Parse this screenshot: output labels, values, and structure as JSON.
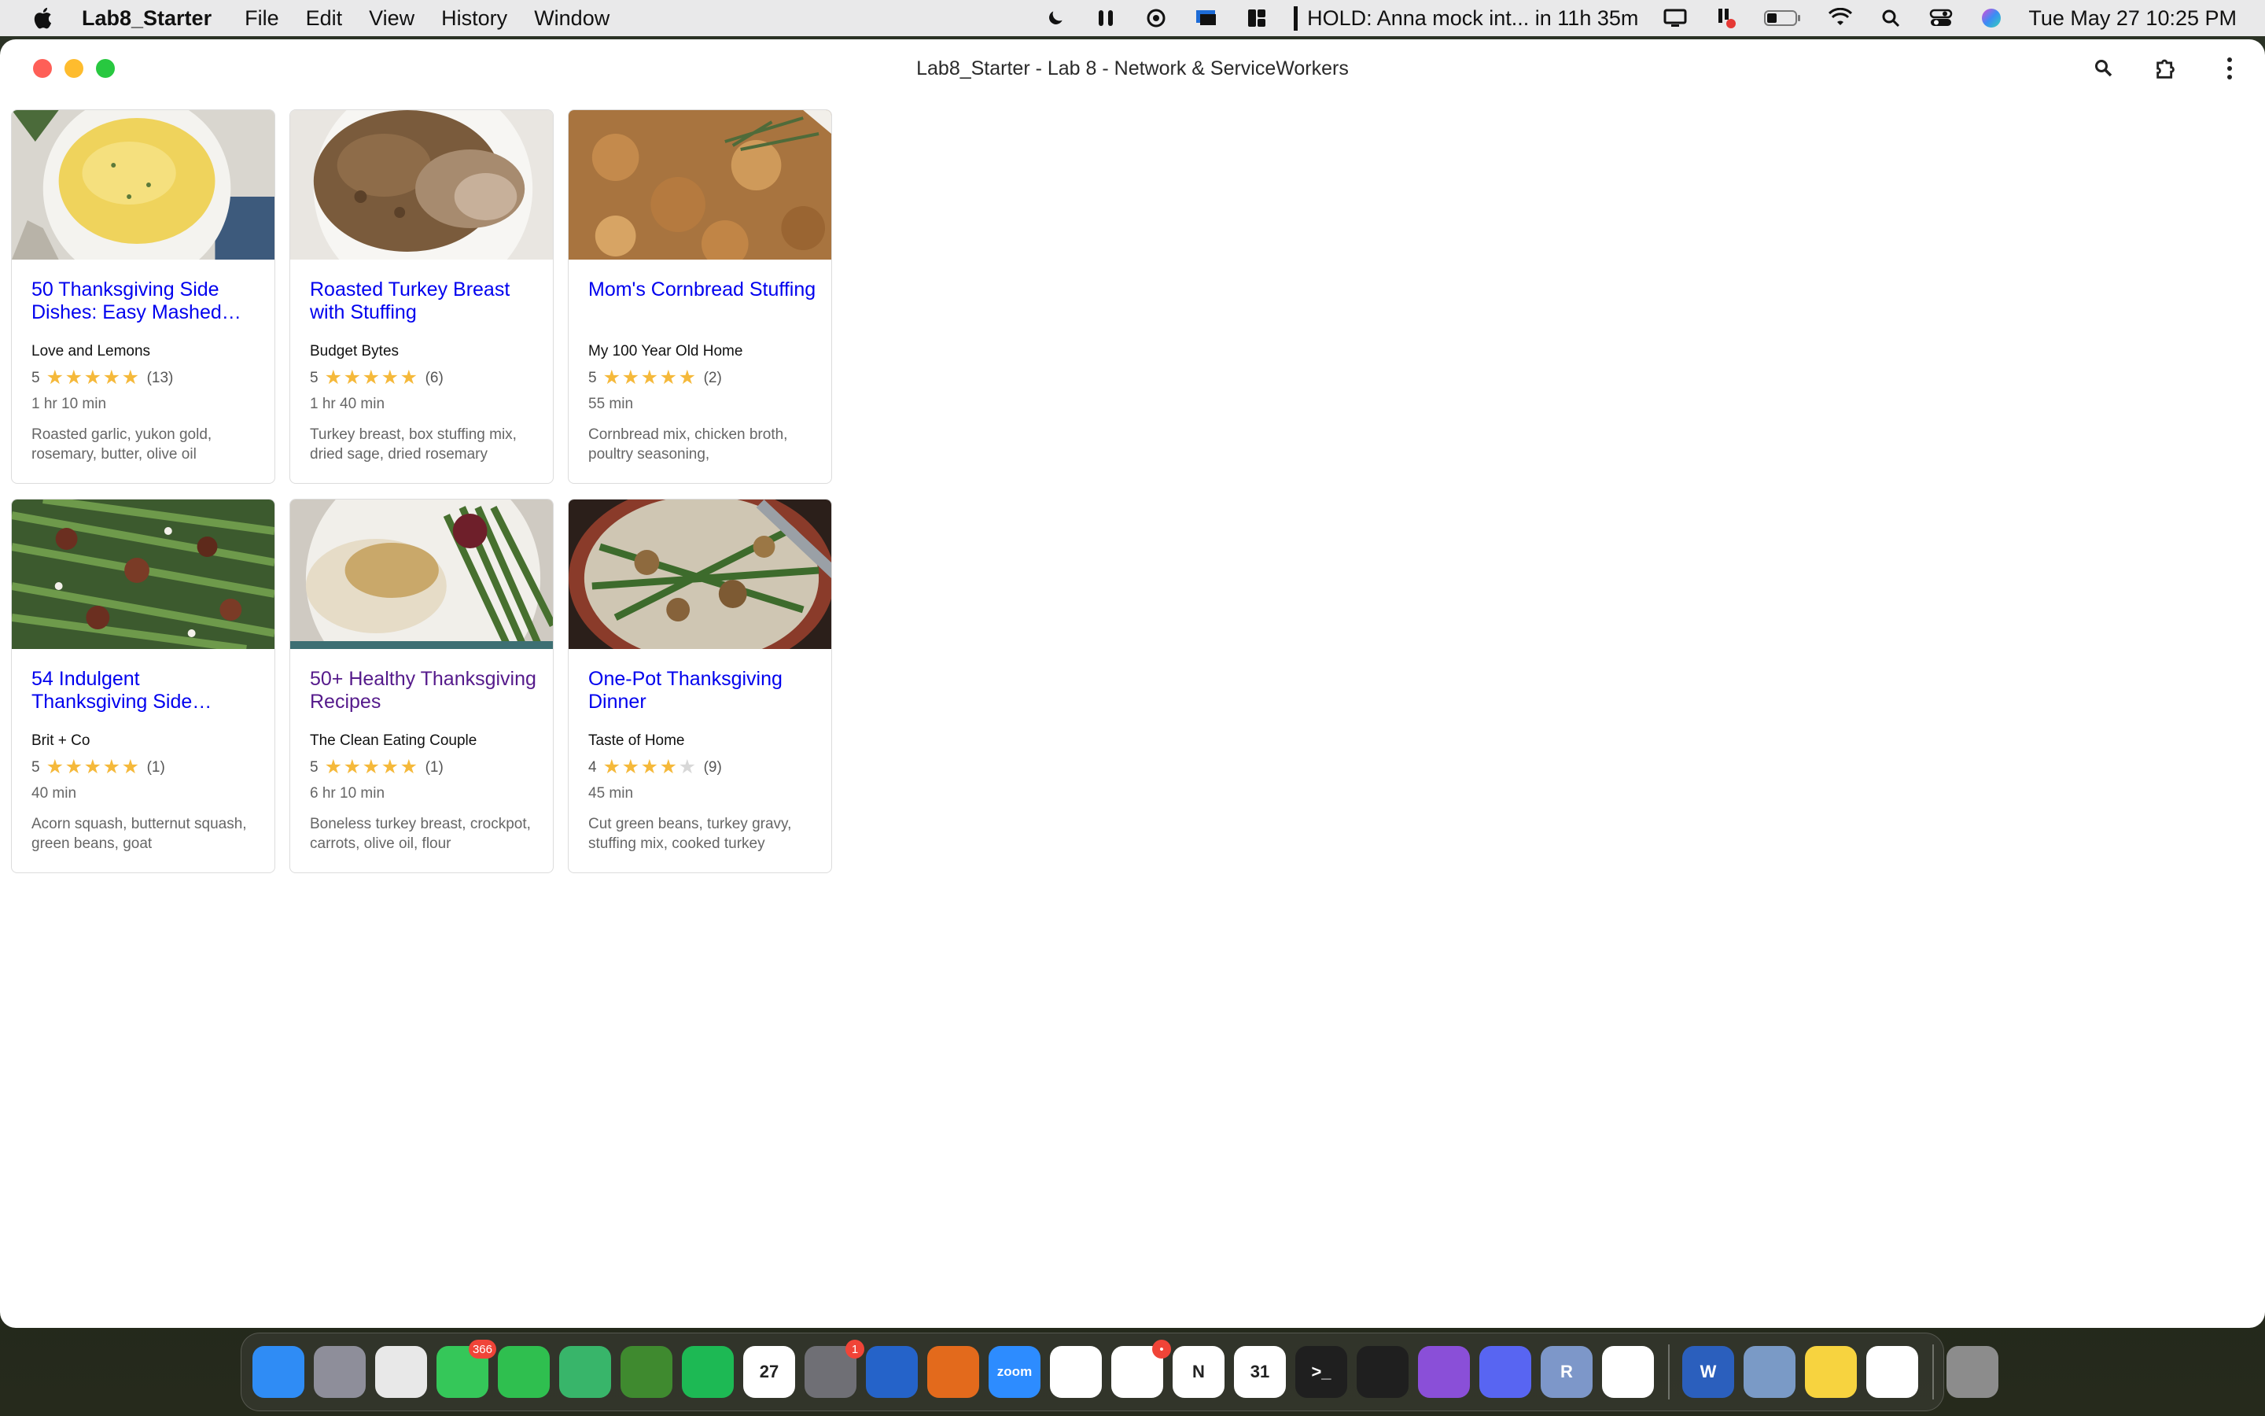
{
  "menubar": {
    "app_name": "Lab8_Starter",
    "menus": [
      "File",
      "Edit",
      "View",
      "History",
      "Window"
    ],
    "status_text": "HOLD:  Anna mock int... in 11h 35m",
    "clock": "Tue May 27  10:25 PM"
  },
  "window": {
    "title": "Lab8_Starter - Lab 8 - Network & ServiceWorkers"
  },
  "colors": {
    "link": "#0000ee",
    "visited_link": "#551a8b",
    "star_filled": "#f5b93b",
    "star_empty": "#d8d8d8"
  },
  "recipes": [
    {
      "title": "50 Thanksgiving Side Dishes: Easy Mashed…",
      "org": "Love and Lemons",
      "rating": 5,
      "reviews": "(13)",
      "time": "1 hr 10 min",
      "ingredients": "Roasted garlic, yukon gold, rosemary, butter, olive oil",
      "visited": false
    },
    {
      "title": "Roasted Turkey Breast with Stuffing",
      "org": "Budget Bytes",
      "rating": 5,
      "reviews": "(6)",
      "time": "1 hr 40 min",
      "ingredients": "Turkey breast, box stuffing mix, dried sage, dried rosemary",
      "visited": false
    },
    {
      "title": "Mom's Cornbread Stuffing",
      "org": "My 100 Year Old Home",
      "rating": 5,
      "reviews": "(2)",
      "time": "55 min",
      "ingredients": "Cornbread mix, chicken broth, poultry seasoning,",
      "visited": false
    },
    {
      "title": "54 Indulgent Thanksgiving Side…",
      "org": "Brit + Co",
      "rating": 5,
      "reviews": "(1)",
      "time": "40 min",
      "ingredients": "Acorn squash, butternut squash, green beans, goat",
      "visited": false
    },
    {
      "title": "50+ Healthy Thanksgiving Recipes",
      "org": "The Clean Eating Couple",
      "rating": 5,
      "reviews": "(1)",
      "time": "6 hr 10 min",
      "ingredients": "Boneless turkey breast, crockpot, carrots, olive oil, flour",
      "visited": true
    },
    {
      "title": "One-Pot Thanksgiving Dinner",
      "org": "Taste of Home",
      "rating": 4,
      "reviews": "(9)",
      "time": "45 min",
      "ingredients": "Cut green beans, turkey gravy, stuffing mix, cooked turkey",
      "visited": false
    }
  ],
  "dock": {
    "apps": [
      {
        "name": "finder-icon",
        "label": "",
        "color": "#2f8cf5"
      },
      {
        "name": "launchpad-icon",
        "label": "",
        "color": "#8e8e9a"
      },
      {
        "name": "chrome-icon",
        "label": "",
        "color": "#e8e8e8"
      },
      {
        "name": "messages-icon",
        "label": "",
        "color": "#35c759",
        "badge": "366"
      },
      {
        "name": "facetime-icon",
        "label": "",
        "color": "#2fbf4f"
      },
      {
        "name": "find-my-icon",
        "label": "",
        "color": "#38b56a"
      },
      {
        "name": "minecraft-icon",
        "label": "",
        "color": "#3f8a2f"
      },
      {
        "name": "spotify-icon",
        "label": "",
        "color": "#1db954"
      },
      {
        "name": "calendar-icon",
        "label": "27",
        "color": "#ffffff"
      },
      {
        "name": "system-settings-icon",
        "label": "",
        "color": "#6f6f75",
        "badge": "1"
      },
      {
        "name": "teams-icon",
        "label": "",
        "color": "#2563c9"
      },
      {
        "name": "matlab-icon",
        "label": "",
        "color": "#e36a1c"
      },
      {
        "name": "zoom-icon",
        "label": "zoom",
        "color": "#2d8cff"
      },
      {
        "name": "chatgpt-icon",
        "label": "",
        "color": "#ffffff"
      },
      {
        "name": "slack-icon",
        "label": "",
        "color": "#ffffff",
        "badge": "•"
      },
      {
        "name": "notion-icon",
        "label": "N",
        "color": "#ffffff"
      },
      {
        "name": "notion-calendar-icon",
        "label": "31",
        "color": "#ffffff"
      },
      {
        "name": "terminal-icon",
        "label": ">_",
        "color": "#1f1f1f"
      },
      {
        "name": "activity-monitor-icon",
        "label": "",
        "color": "#1f1f1f"
      },
      {
        "name": "github-desktop-icon",
        "label": "",
        "color": "#8a4fd8"
      },
      {
        "name": "discord-icon",
        "label": "",
        "color": "#5865f2"
      },
      {
        "name": "r-icon",
        "label": "R",
        "color": "#7d97c9"
      },
      {
        "name": "vscode-icon",
        "label": "",
        "color": "#ffffff"
      },
      {
        "name": "word-icon",
        "label": "W",
        "color": "#2b5fbd"
      },
      {
        "name": "preview-icon",
        "label": "",
        "color": "#7a9ac6"
      },
      {
        "name": "notes-icon",
        "label": "",
        "color": "#f7d33f"
      },
      {
        "name": "chrome-app-icon",
        "label": "",
        "color": "#ffffff"
      },
      {
        "name": "trash-icon",
        "label": "",
        "color": "#8c8c8c"
      }
    ]
  }
}
